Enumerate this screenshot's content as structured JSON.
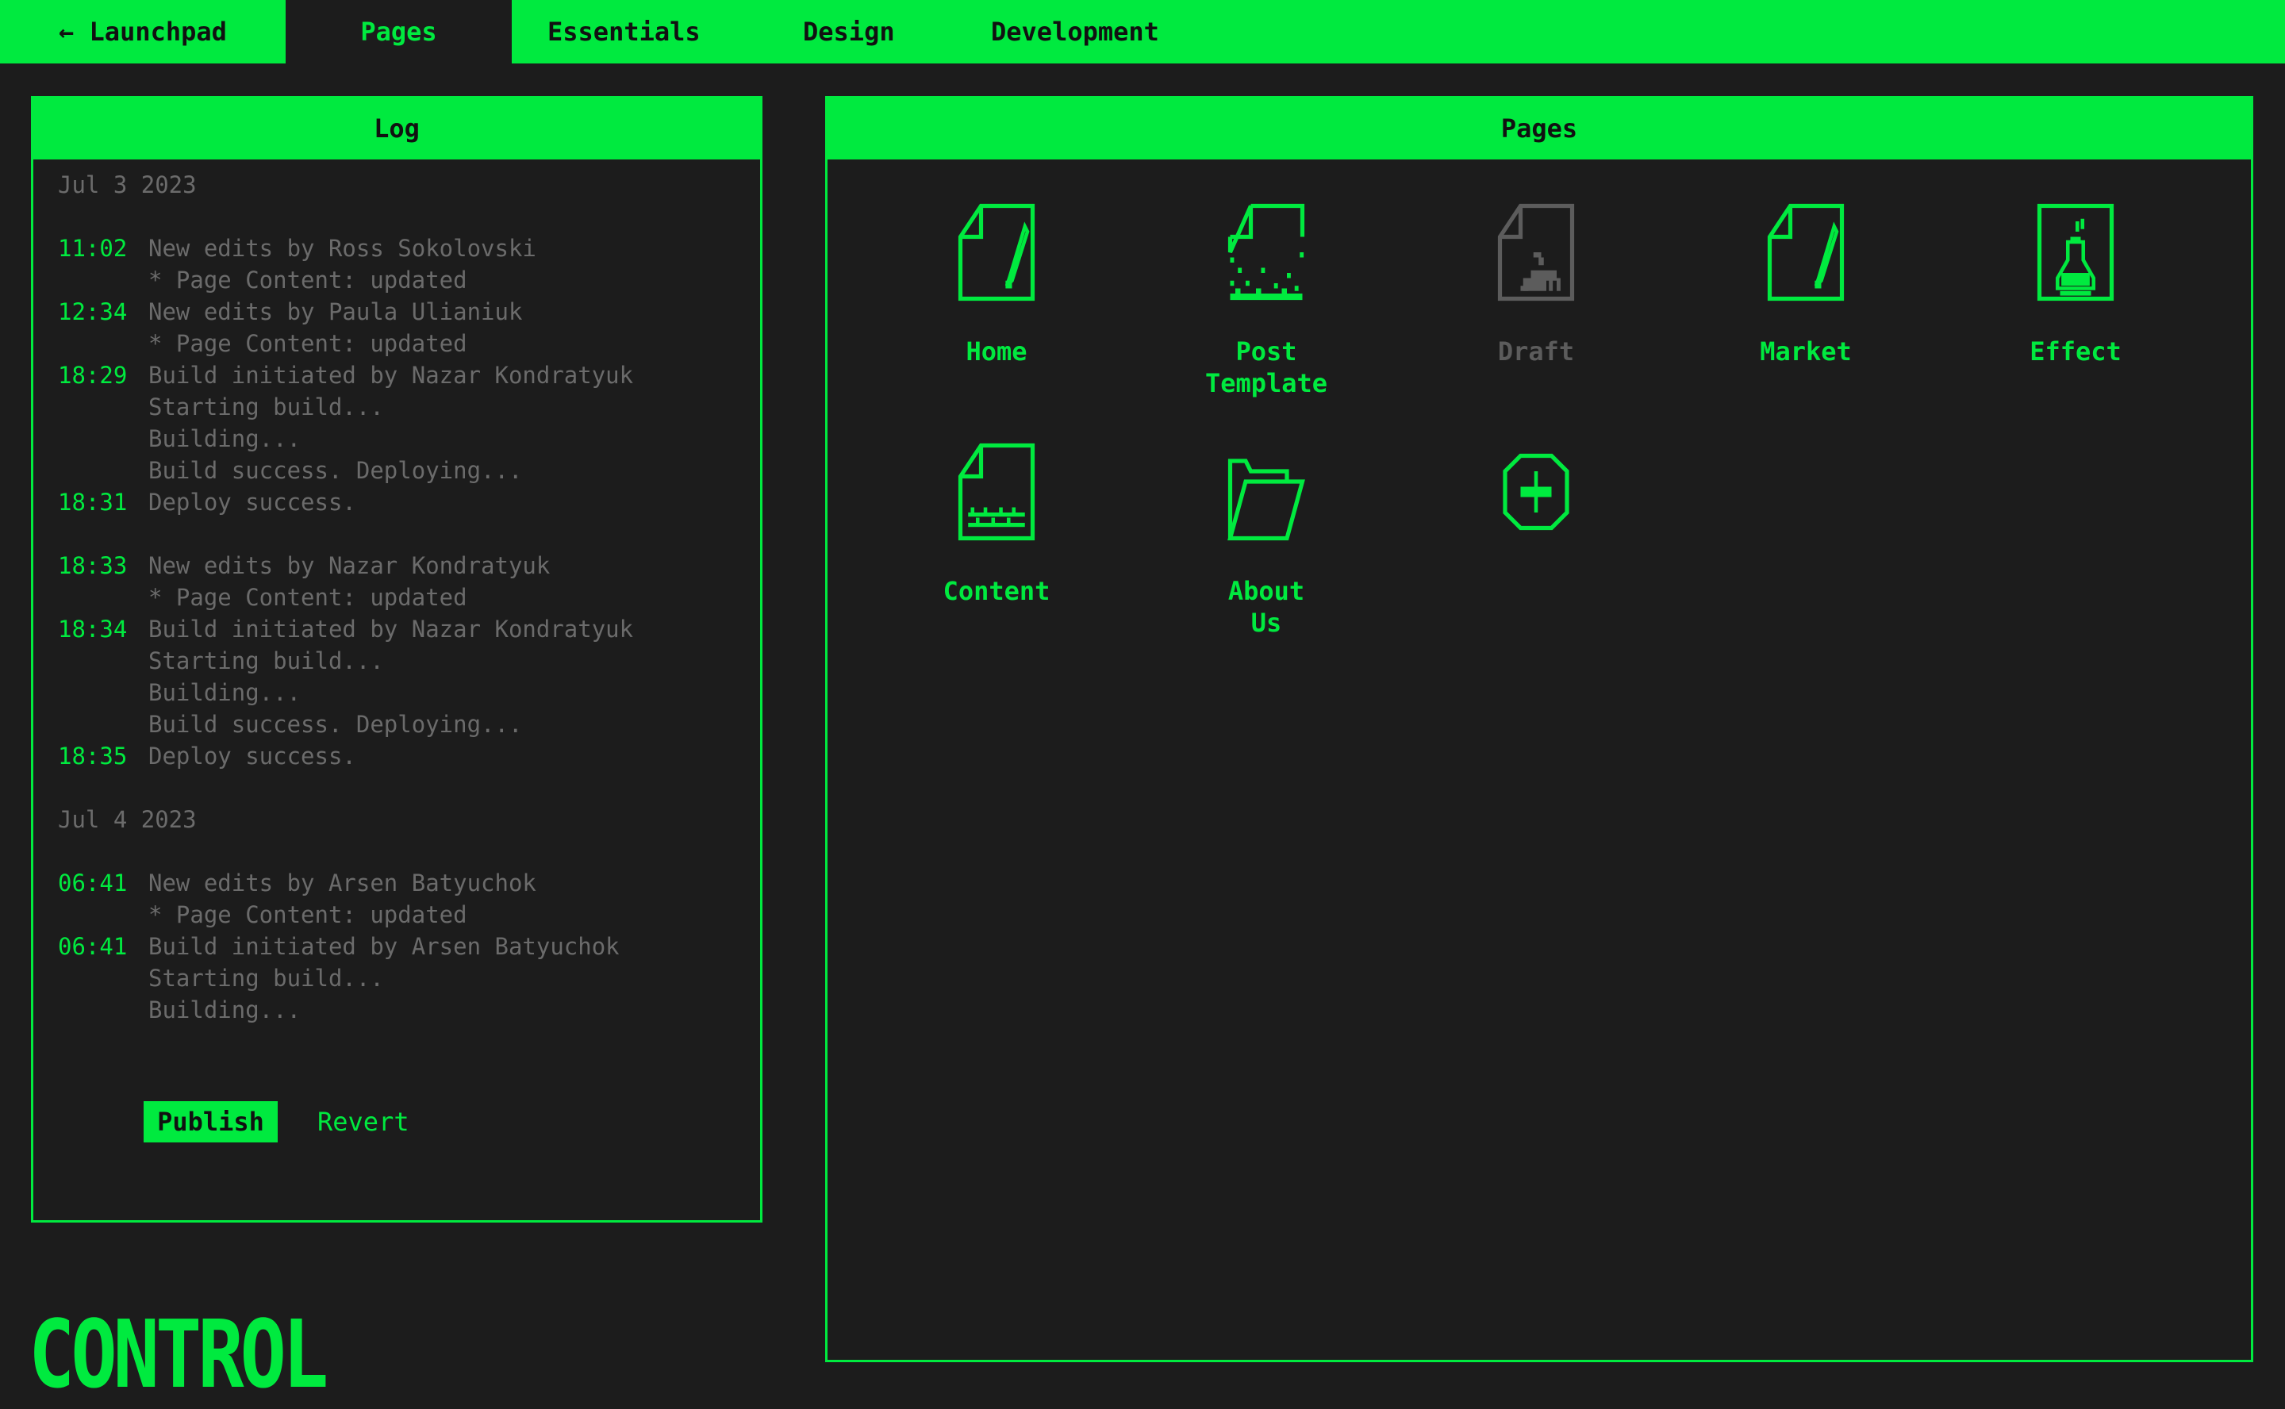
{
  "nav": {
    "back_label": "← Launchpad",
    "tabs": [
      "Pages",
      "Essentials",
      "Design",
      "Development"
    ],
    "active_tab": "Pages"
  },
  "log": {
    "title": "Log",
    "days": [
      {
        "date": "Jul 3 2023",
        "groups": [
          [
            {
              "time": "11:02",
              "text": "New edits by Ross Sokolovski"
            },
            {
              "time": "",
              "text": "* Page Content: updated"
            },
            {
              "time": "12:34",
              "text": "New edits by Paula Ulianiuk"
            },
            {
              "time": "",
              "text": "* Page Content: updated"
            },
            {
              "time": "18:29",
              "text": "Build initiated by Nazar Kondratyuk"
            },
            {
              "time": "",
              "text": "Starting build..."
            },
            {
              "time": "",
              "text": "Building..."
            },
            {
              "time": "",
              "text": "Build success. Deploying..."
            },
            {
              "time": "18:31",
              "text": "Deploy success."
            }
          ],
          [
            {
              "time": "18:33",
              "text": "New edits by Nazar Kondratyuk"
            },
            {
              "time": "",
              "text": "* Page Content: updated"
            },
            {
              "time": "18:34",
              "text": "Build initiated by Nazar Kondratyuk"
            },
            {
              "time": "",
              "text": "Starting build..."
            },
            {
              "time": "",
              "text": "Building..."
            },
            {
              "time": "",
              "text": "Build success. Deploying..."
            },
            {
              "time": "18:35",
              "text": "Deploy success."
            }
          ]
        ]
      },
      {
        "date": "Jul 4 2023",
        "groups": [
          [
            {
              "time": "06:41",
              "text": "New edits by Arsen Batyuchok"
            },
            {
              "time": "",
              "text": "* Page Content: updated"
            },
            {
              "time": "06:41",
              "text": "Build initiated by Arsen Batyuchok"
            },
            {
              "time": "",
              "text": "Starting build..."
            },
            {
              "time": "",
              "text": "Building..."
            }
          ]
        ]
      }
    ],
    "publish_label": "Publish",
    "revert_label": "Revert"
  },
  "pages": {
    "title": "Pages",
    "items": [
      {
        "label": "Home",
        "icon": "document-pen-icon",
        "state": "active"
      },
      {
        "label": "Post\nTemplate",
        "icon": "document-dissolve-icon",
        "state": "active"
      },
      {
        "label": "Draft",
        "icon": "document-rabbit-icon",
        "state": "disabled"
      },
      {
        "label": "Market",
        "icon": "document-pen-icon",
        "state": "active"
      },
      {
        "label": "Effect",
        "icon": "potion-flask-icon",
        "state": "active"
      },
      {
        "label": "Content",
        "icon": "document-text-icon",
        "state": "active"
      },
      {
        "label": "About\nUs",
        "icon": "folder-open-icon",
        "state": "active"
      }
    ],
    "add_icon": "plus-circle-icon"
  },
  "logo": {
    "text": "CONTROL"
  },
  "colors": {
    "accent": "#00ea3f",
    "background": "#1c1c1c",
    "muted": "#6b6b6b",
    "disabled": "#5c5c5c"
  }
}
